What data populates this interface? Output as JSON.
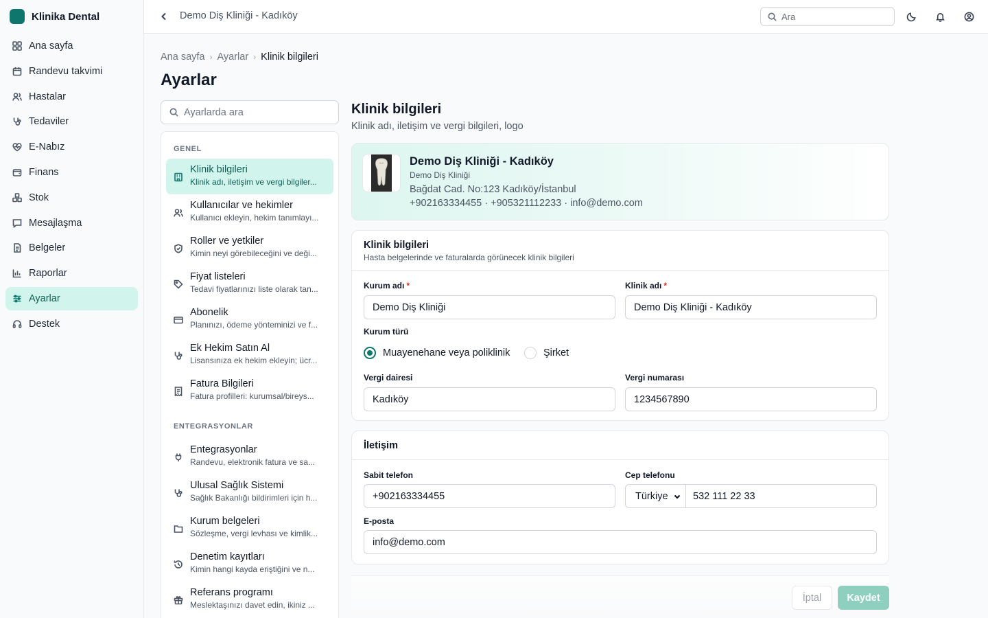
{
  "app": {
    "name": "Klinika Dental"
  },
  "sidebar": {
    "items": [
      {
        "label": "Ana sayfa",
        "icon": "grid-icon"
      },
      {
        "label": "Randevu takvimi",
        "icon": "calendar-icon"
      },
      {
        "label": "Hastalar",
        "icon": "users-icon"
      },
      {
        "label": "Tedaviler",
        "icon": "stethoscope-icon"
      },
      {
        "label": "E-Nabız",
        "icon": "heart-pulse-icon"
      },
      {
        "label": "Finans",
        "icon": "wallet-icon"
      },
      {
        "label": "Stok",
        "icon": "boxes-icon"
      },
      {
        "label": "Mesajlaşma",
        "icon": "message-icon"
      },
      {
        "label": "Belgeler",
        "icon": "document-icon"
      },
      {
        "label": "Raporlar",
        "icon": "bar-chart-icon"
      },
      {
        "label": "Ayarlar",
        "icon": "sliders-icon",
        "active": true
      },
      {
        "label": "Destek",
        "icon": "headset-icon"
      }
    ]
  },
  "topbar": {
    "title": "Demo Diş Kliniği - Kadıköy",
    "search_placeholder": "Ara"
  },
  "breadcrumb": [
    "Ana sayfa",
    "Ayarlar",
    "Klinik bilgileri"
  ],
  "page_title": "Ayarlar",
  "settings": {
    "search_placeholder": "Ayarlarda ara",
    "group_general": "GENEL",
    "group_integrations": "ENTEGRASYONLAR",
    "general_items": [
      {
        "title": "Klinik bilgileri",
        "desc": "Klinik adı, iletişim ve vergi bilgiler...",
        "icon": "building-icon",
        "active": true
      },
      {
        "title": "Kullanıcılar ve hekimler",
        "desc": "Kullanıcı ekleyin, hekim tanımlayı...",
        "icon": "users-icon"
      },
      {
        "title": "Roller ve yetkiler",
        "desc": "Kimin neyi görebileceğini ve deği...",
        "icon": "shield-icon"
      },
      {
        "title": "Fiyat listeleri",
        "desc": "Tedavi fiyatlarınızı liste olarak tan...",
        "icon": "tag-icon"
      },
      {
        "title": "Abonelik",
        "desc": "Planınızı, ödeme yönteminizi ve f...",
        "icon": "credit-card-icon"
      },
      {
        "title": "Ek Hekim Satın Al",
        "desc": "Lisansınıza ek hekim ekleyin; ücr...",
        "icon": "stethoscope-icon"
      },
      {
        "title": "Fatura Bilgileri",
        "desc": "Fatura profilleri: kurumsal/bireys...",
        "icon": "receipt-icon"
      }
    ],
    "integration_items": [
      {
        "title": "Entegrasyonlar",
        "desc": "Randevu, elektronik fatura ve sa...",
        "icon": "plug-icon"
      },
      {
        "title": "Ulusal Sağlık Sistemi",
        "desc": "Sağlık Bakanlığı bildirimleri için h...",
        "icon": "stethoscope-icon"
      },
      {
        "title": "Kurum belgeleri",
        "desc": "Sözleşme, vergi levhası ve kimlik...",
        "icon": "folder-icon"
      },
      {
        "title": "Denetim kayıtları",
        "desc": "Kimin hangi kayda eriştiğini ve n...",
        "icon": "history-icon"
      },
      {
        "title": "Referans programı",
        "desc": "Meslektaşınızı davet edin, ikiniz ...",
        "icon": "gift-icon"
      }
    ]
  },
  "content": {
    "title": "Klinik bilgileri",
    "subtitle": "Klinik adı, iletişim ve vergi bilgileri, logo"
  },
  "hero": {
    "name": "Demo Diş Kliniği - Kadıköy",
    "institution": "Demo Diş Kliniği",
    "address": "Bağdat Cad. No:123 Kadıköy/İstanbul",
    "contact": "+902163334455 · +905321112233 · info@demo.com"
  },
  "clinic_card": {
    "title": "Klinik bilgileri",
    "subtitle": "Hasta belgelerinde ve faturalarda görünecek klinik bilgileri",
    "institution_label": "Kurum adı",
    "institution_value": "Demo Diş Kliniği",
    "clinic_label": "Klinik adı",
    "clinic_value": "Demo Diş Kliniği - Kadıköy",
    "type_label": "Kurum türü",
    "type_options": [
      "Muayenehane veya poliklinik",
      "Şirket"
    ],
    "type_selected": "Muayenehane veya poliklinik",
    "tax_office_label": "Vergi dairesi",
    "tax_office_value": "Kadıköy",
    "tax_number_label": "Vergi numarası",
    "tax_number_value": "1234567890"
  },
  "contact_card": {
    "title": "İletişim",
    "landline_label": "Sabit telefon",
    "landline_value": "+902163334455",
    "mobile_label": "Cep telefonu",
    "country_value": "Türkiye",
    "mobile_value": "532 111 22 33",
    "email_label": "E-posta",
    "email_value": "info@demo.com"
  },
  "actions": {
    "cancel": "İptal",
    "save": "Kaydet"
  },
  "colors": {
    "accent": "#0f766e",
    "active_bg": "#d1f5ec",
    "save_button": "#8fcfc0"
  }
}
